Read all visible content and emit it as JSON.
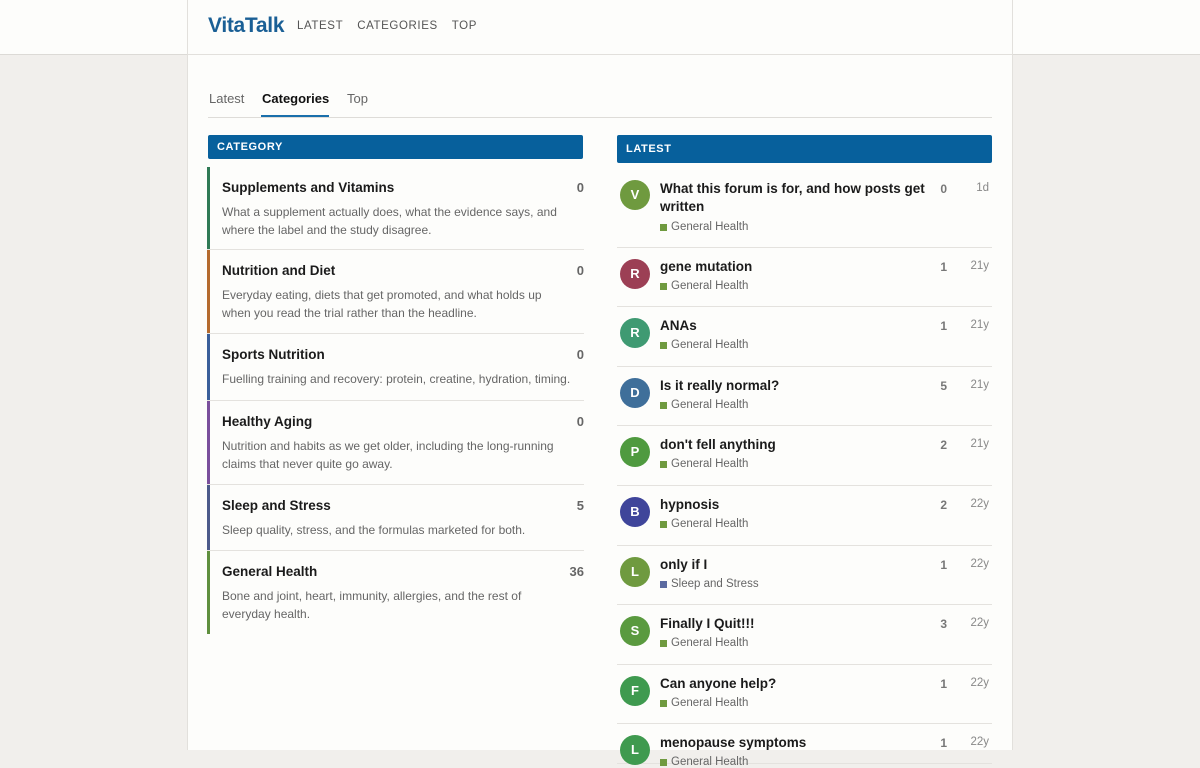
{
  "header": {
    "logo": "VitaTalk",
    "nav": [
      "LATEST",
      "CATEGORIES",
      "TOP"
    ]
  },
  "tabs": [
    "Latest",
    "Categories",
    "Top"
  ],
  "active_tab": "Categories",
  "category_header": "CATEGORY",
  "latest_header": "LATEST",
  "categories": [
    {
      "name": "Supplements and Vitamins",
      "count": "0",
      "desc": "What a supplement actually does, what the evidence says, and where the label and the study disagree.",
      "color": "#2f7a55"
    },
    {
      "name": "Nutrition and Diet",
      "count": "0",
      "desc": "Everyday eating, diets that get promoted, and what holds up when you read the trial rather than the headline.",
      "color": "#b46a2e"
    },
    {
      "name": "Sports Nutrition",
      "count": "0",
      "desc": "Fuelling training and recovery: protein, creatine, hydration, timing.",
      "color": "#3a5f9a"
    },
    {
      "name": "Healthy Aging",
      "count": "0",
      "desc": "Nutrition and habits as we get older, including the long-running claims that never quite go away.",
      "color": "#7a4f9c"
    },
    {
      "name": "Sleep and Stress",
      "count": "5",
      "desc": "Sleep quality, stress, and the formulas marketed for both.",
      "color": "#4c5a8a"
    },
    {
      "name": "General Health",
      "count": "36",
      "desc": "Bone and joint, heart, immunity, allergies, and the rest of everyday health.",
      "color": "#5f8f3e"
    }
  ],
  "topics": [
    {
      "initial": "V",
      "avatar_color": "#6f9a3f",
      "title": "What this forum is for, and how posts get written",
      "category": "General Health",
      "cat_color": "#6f9a3f",
      "replies": "0",
      "age": "1d"
    },
    {
      "initial": "R",
      "avatar_color": "#9c3f55",
      "title": "gene mutation",
      "category": "General Health",
      "cat_color": "#6f9a3f",
      "replies": "1",
      "age": "21y"
    },
    {
      "initial": "R",
      "avatar_color": "#3f9a72",
      "title": "ANAs",
      "category": "General Health",
      "cat_color": "#6f9a3f",
      "replies": "1",
      "age": "21y"
    },
    {
      "initial": "D",
      "avatar_color": "#3f6f9a",
      "title": "Is it really normal?",
      "category": "General Health",
      "cat_color": "#6f9a3f",
      "replies": "5",
      "age": "21y"
    },
    {
      "initial": "P",
      "avatar_color": "#4f9a3f",
      "title": "don't fell anything",
      "category": "General Health",
      "cat_color": "#6f9a3f",
      "replies": "2",
      "age": "21y"
    },
    {
      "initial": "B",
      "avatar_color": "#3f459a",
      "title": "hypnosis",
      "category": "General Health",
      "cat_color": "#6f9a3f",
      "replies": "2",
      "age": "22y"
    },
    {
      "initial": "L",
      "avatar_color": "#6f9a3f",
      "title": "only if I",
      "category": "Sleep and Stress",
      "cat_color": "#5b6aa0",
      "replies": "1",
      "age": "22y"
    },
    {
      "initial": "S",
      "avatar_color": "#5a9a3f",
      "title": "Finally I Quit!!!",
      "category": "General Health",
      "cat_color": "#6f9a3f",
      "replies": "3",
      "age": "22y"
    },
    {
      "initial": "F",
      "avatar_color": "#3f9a4f",
      "title": "Can anyone help?",
      "category": "General Health",
      "cat_color": "#6f9a3f",
      "replies": "1",
      "age": "22y"
    },
    {
      "initial": "L",
      "avatar_color": "#3f9a4f",
      "title": "menopause symptoms",
      "category": "General Health",
      "cat_color": "#6f9a3f",
      "replies": "1",
      "age": "22y"
    }
  ]
}
